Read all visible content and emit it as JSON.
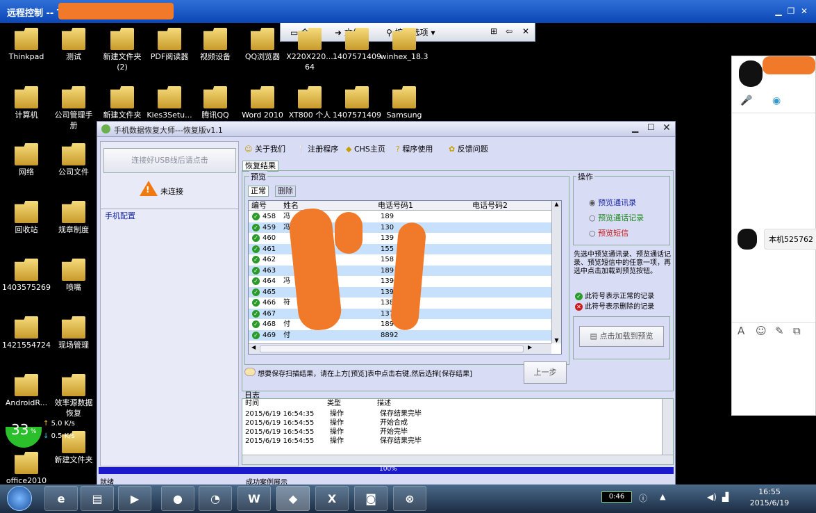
{
  "outer_window": {
    "title": "远程控制 -- Thi"
  },
  "conn_bar": {
    "chat": "会话",
    "file": "文件",
    "control": "控制选项"
  },
  "desktop": [
    {
      "label": "Thinkpad"
    },
    {
      "label": "测试"
    },
    {
      "label": "新建文件夹\n(2)"
    },
    {
      "label": "PDF阅读器"
    },
    {
      "label": "视频设备"
    },
    {
      "label": "QQ浏览器"
    },
    {
      "label": "X220X220...\n64"
    },
    {
      "label": "1407571409"
    },
    {
      "label": "winhex_18.3"
    },
    {
      "label": "计算机"
    },
    {
      "label": "公司管理手\n册"
    },
    {
      "label": "新建文件夹"
    },
    {
      "label": "Kies3Setu..."
    },
    {
      "label": "腾讯QQ"
    },
    {
      "label": "Word 2010"
    },
    {
      "label": "XT800 个人"
    },
    {
      "label": "1407571409"
    },
    {
      "label": "Samsung"
    },
    {
      "label": "网络"
    },
    {
      "label": "公司文件"
    },
    {
      "label": "回收站"
    },
    {
      "label": "规章制度"
    },
    {
      "label": "1403575269"
    },
    {
      "label": "喷嘴"
    },
    {
      "label": "1421554724"
    },
    {
      "label": "现场管理"
    },
    {
      "label": "AndroidR..."
    },
    {
      "label": "效率源数据\n恢复"
    },
    {
      "label": "office2010\n副本激活"
    },
    {
      "label": "新建文件夹"
    }
  ],
  "net_widget": {
    "percent": "33",
    "unit": "%",
    "up": "5.0",
    "down": "0.5",
    "rate_unit": "K/s"
  },
  "app": {
    "title": "手机数据恢复大师---恢复版v1.1",
    "usb_button": "连接好USB线后请点击",
    "status": "未连接",
    "phone_config": "手机配置",
    "toolbar": [
      "关于我们",
      "注册程序",
      "CHS主页",
      "程序使用",
      "反馈问题"
    ],
    "result_tab": "恢复结果",
    "preview_label": "预览",
    "tabs": [
      "正常",
      "删除"
    ],
    "columns": [
      "编号",
      "姓名",
      "电话号码1",
      "电话号码2"
    ],
    "rows": [
      {
        "id": "458",
        "name": "冯",
        "p1": "189",
        "p2": ""
      },
      {
        "id": "459",
        "name": "冯",
        "p1": "130",
        "p2": ""
      },
      {
        "id": "460",
        "name": "",
        "p1": "139",
        "p2": ""
      },
      {
        "id": "461",
        "name": "",
        "p1": "155",
        "p2": ""
      },
      {
        "id": "462",
        "name": "",
        "p1": "158",
        "p2": ""
      },
      {
        "id": "463",
        "name": "",
        "p1": "189",
        "p2": ""
      },
      {
        "id": "464",
        "name": "冯",
        "p1": "1399",
        "p2": ""
      },
      {
        "id": "465",
        "name": "",
        "p1": "1398",
        "p2": ""
      },
      {
        "id": "466",
        "name": "符",
        "p1": "1388",
        "p2": ""
      },
      {
        "id": "467",
        "name": "",
        "p1": "1370",
        "p2": ""
      },
      {
        "id": "468",
        "name": "付",
        "p1": "1898",
        "p2": ""
      },
      {
        "id": "469",
        "name": "付",
        "p1": "8892",
        "p2": ""
      }
    ],
    "ops_label": "操作",
    "radio_options": [
      "预览通讯录",
      "预览通话记录",
      "预览短信"
    ],
    "radio_colors": [
      "#1a2aa8",
      "#1a8a1a",
      "#c81a1a"
    ],
    "ops_help": "先选中预览通讯录、预览通话记录、预览短信中的任意一项，再选中点击加载到预览按钮。",
    "legend_normal": "此符号表示正常的记录",
    "legend_deleted": "此符号表示删除的记录",
    "load_button": "点击加载到预览",
    "save_hint": "想要保存扫描结果，请在上方[预览]表中点击右键,然后选择[保存结果]",
    "prev_button": "上一步",
    "log_label": "日志",
    "log_columns": [
      "时间",
      "类型",
      "描述"
    ],
    "log_rows": [
      {
        "time": "2015/6/19 16:54:35",
        "type": "操作",
        "desc": "保存结果完毕"
      },
      {
        "time": "2015/6/19 16:54:55",
        "type": "操作",
        "desc": "开始合成"
      },
      {
        "time": "2015/6/19 16:54:55",
        "type": "操作",
        "desc": "开始完毕"
      },
      {
        "time": "2015/6/19 16:54:55",
        "type": "操作",
        "desc": "保存结果完毕"
      }
    ],
    "progress": "100%",
    "status_left": "就绪",
    "status_right": "成功案例展示"
  },
  "qq_panel": {
    "message": "本机525762"
  },
  "taskbar": {
    "clock_time": "16:55",
    "clock_date": "2015/6/19",
    "battery": "0:46"
  }
}
